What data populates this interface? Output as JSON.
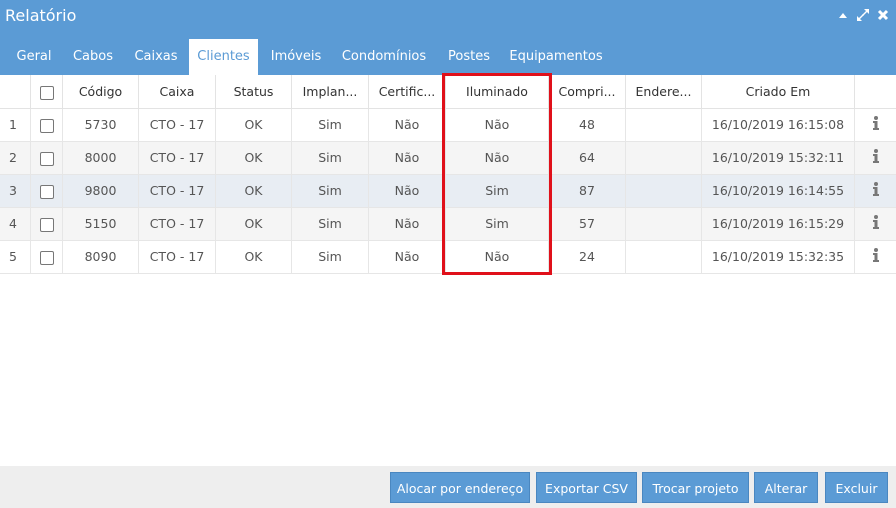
{
  "window": {
    "title": "Relatório"
  },
  "tabs": [
    "Geral",
    "Cabos",
    "Caixas",
    "Clientes",
    "Imóveis",
    "Condomínios",
    "Postes",
    "Equipamentos"
  ],
  "active_tab": "Clientes",
  "columns": [
    "Código",
    "Caixa",
    "Status",
    "Implan...",
    "Certific...",
    "Iluminado",
    "Compri...",
    "Endere...",
    "Criado Em"
  ],
  "rows": [
    {
      "num": "1",
      "codigo": "5730",
      "caixa": "CTO - 17",
      "status": "OK",
      "implan": "Sim",
      "certific": "Não",
      "iluminado": "Não",
      "compri": "48",
      "endere": "",
      "criado": "16/10/2019 16:15:08"
    },
    {
      "num": "2",
      "codigo": "8000",
      "caixa": "CTO - 17",
      "status": "OK",
      "implan": "Sim",
      "certific": "Não",
      "iluminado": "Não",
      "compri": "64",
      "endere": "",
      "criado": "16/10/2019 15:32:11"
    },
    {
      "num": "3",
      "codigo": "9800",
      "caixa": "CTO - 17",
      "status": "OK",
      "implan": "Sim",
      "certific": "Não",
      "iluminado": "Sim",
      "compri": "87",
      "endere": "",
      "criado": "16/10/2019 16:14:55"
    },
    {
      "num": "4",
      "codigo": "5150",
      "caixa": "CTO - 17",
      "status": "OK",
      "implan": "Sim",
      "certific": "Não",
      "iluminado": "Sim",
      "compri": "57",
      "endere": "",
      "criado": "16/10/2019 16:15:29"
    },
    {
      "num": "5",
      "codigo": "8090",
      "caixa": "CTO - 17",
      "status": "OK",
      "implan": "Sim",
      "certific": "Não",
      "iluminado": "Não",
      "compri": "24",
      "endere": "",
      "criado": "16/10/2019 15:32:35"
    }
  ],
  "buttons": {
    "alocar": "Alocar por endereço",
    "exportar": "Exportar CSV",
    "trocar": "Trocar projeto",
    "alterar": "Alterar",
    "excluir": "Excluir"
  },
  "icons": {
    "minimize": "caret-up-icon",
    "maximize": "expand-icon",
    "close": "close-icon",
    "row_info": "info-icon"
  },
  "colors": {
    "accent": "#5b9bd5",
    "highlight": "#e0101a"
  }
}
